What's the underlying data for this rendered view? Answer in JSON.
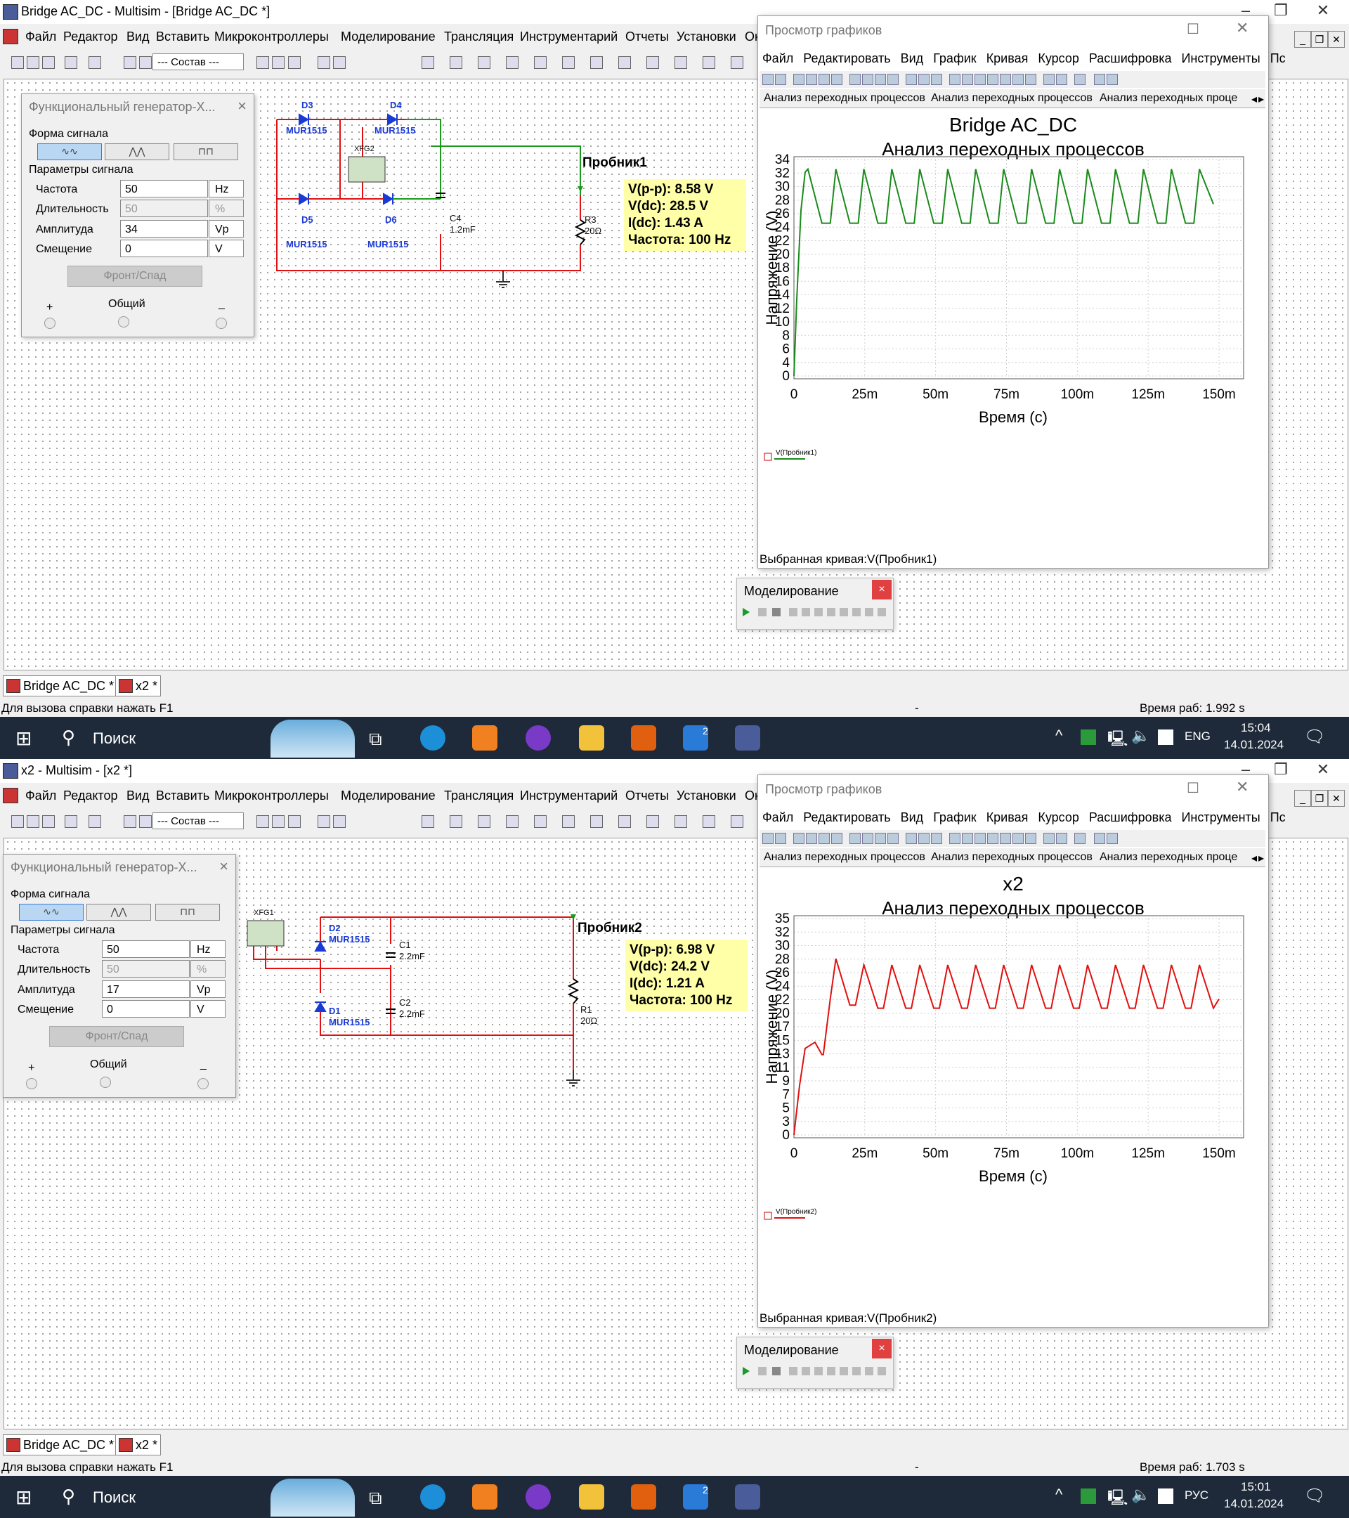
{
  "top": {
    "window_title": "Bridge AC_DC - Multisim - [Bridge AC_DC *]",
    "menu": [
      "Файл",
      "Редактор",
      "Вид",
      "Вставить",
      "Микроконтроллеры",
      "Моделирование",
      "Трансляция",
      "Инструментарий",
      "Отчеты",
      "Установки",
      "Ок"
    ],
    "combo": "--- Состав ---",
    "func_gen": {
      "title": "Функциональный генератор-X...",
      "waveform_label": "Форма сигнала",
      "params_label": "Параметры сигнала",
      "freq_label": "Частота",
      "freq_value": "50",
      "freq_unit": "Hz",
      "duty_label": "Длительность",
      "duty_value": "50",
      "duty_unit": "%",
      "amp_label": "Амплитуда",
      "amp_value": "34",
      "amp_unit": "Vp",
      "offset_label": "Смещение",
      "offset_value": "0",
      "offset_unit": "V",
      "edge_button": "Фронт/Спад",
      "plus": "+",
      "common": "Общий",
      "minus": "_"
    },
    "components": {
      "d3": "D3",
      "d3_model": "MUR1515",
      "d4": "D4",
      "d4_model": "MUR1515",
      "d5": "D5",
      "d5_model": "MUR1515",
      "d6": "D6",
      "d6_model": "MUR1515",
      "xfg": "XFG2",
      "c4": "C4",
      "c4_val": "1.2mF",
      "r3": "R3",
      "r3_val": "20Ω"
    },
    "probe": {
      "name": "Пробник1",
      "vpp": "V(p-p): 8.58 V",
      "vdc": "V(dc): 28.5 V",
      "idc": "I(dc): 1.43 A",
      "freq": "Частота: 100 Hz"
    },
    "grapher": {
      "title": "Просмотр графиков",
      "menu": [
        "Файл",
        "Редактировать",
        "Вид",
        "График",
        "Кривая",
        "Курсор",
        "Расшифровка",
        "Инструменты",
        "Пс"
      ],
      "tabs": [
        "Анализ переходных процессов",
        "Анализ переходных процессов",
        "Анализ переходных проце"
      ],
      "status": "Выбранная кривая:V(Пробник1)"
    },
    "sim": {
      "title": "Моделирование",
      "close": "×"
    },
    "doc_tabs": [
      "Bridge AC_DC *",
      "x2 *"
    ],
    "status_left": "Для вызова справки нажать F1",
    "status_dash": "-",
    "status_right": "Время раб: 1.992 s",
    "taskbar": {
      "search": "Поиск",
      "lang": "ENG",
      "time": "15:04",
      "date": "14.01.2024",
      "badge": "2"
    },
    "chart_data": {
      "type": "line",
      "title": "Bridge AC_DC",
      "subtitle": "Анализ переходных процессов",
      "xlabel": "Время (с)",
      "ylabel": "Напряжение (V)",
      "x_ticks": [
        "0",
        "25m",
        "50m",
        "75m",
        "100m",
        "125m",
        "150m"
      ],
      "y_ticks": [
        "0",
        "4",
        "6",
        "8",
        "10",
        "12",
        "14",
        "16",
        "18",
        "20",
        "22",
        "24",
        "26",
        "28",
        "30",
        "32",
        "34"
      ],
      "xlim": [
        0,
        0.152
      ],
      "ylim": [
        0,
        34
      ],
      "grid": true,
      "series": [
        {
          "name": "V(Пробник1)",
          "color": "#1a8a1a",
          "x": [
            0,
            0.001,
            0.0025,
            0.004,
            0.005,
            0.01,
            0.013,
            0.015,
            0.02,
            0.023,
            0.025,
            0.03,
            0.033,
            0.035,
            0.04,
            0.043,
            0.045,
            0.05,
            0.053,
            0.055,
            0.06,
            0.063,
            0.065,
            0.07,
            0.073,
            0.075,
            0.08,
            0.083,
            0.085,
            0.09,
            0.093,
            0.095,
            0.1,
            0.103,
            0.105,
            0.11,
            0.113,
            0.115,
            0.12,
            0.123,
            0.125,
            0.13,
            0.133,
            0.135,
            0.14,
            0.143,
            0.145,
            0.15,
            0.152
          ],
          "y": [
            0,
            12,
            26,
            32,
            32.5,
            24,
            24,
            32.5,
            24,
            24,
            32.5,
            24,
            24,
            32.5,
            24,
            24,
            32.5,
            24,
            24,
            32.5,
            24,
            24,
            32.5,
            24,
            24,
            32.5,
            24,
            24,
            32.5,
            24,
            24,
            32.5,
            24,
            24,
            32.5,
            24,
            24,
            32.5,
            24,
            24,
            32.5,
            24,
            24,
            32.5,
            24,
            24,
            32.5,
            27
          ]
        }
      ]
    }
  },
  "bottom": {
    "window_title": "x2 - Multisim - [x2 *]",
    "menu": [
      "Файл",
      "Редактор",
      "Вид",
      "Вставить",
      "Микроконтроллеры",
      "Моделирование",
      "Трансляция",
      "Инструментарий",
      "Отчеты",
      "Установки",
      "Ок"
    ],
    "combo": "--- Состав ---",
    "func_gen": {
      "title": "Функциональный генератор-X...",
      "waveform_label": "Форма сигнала",
      "params_label": "Параметры сигнала",
      "freq_label": "Частота",
      "freq_value": "50",
      "freq_unit": "Hz",
      "duty_label": "Длительность",
      "duty_value": "50",
      "duty_unit": "%",
      "amp_label": "Амплитуда",
      "amp_value": "17",
      "amp_unit": "Vp",
      "offset_label": "Смещение",
      "offset_value": "0",
      "offset_unit": "V",
      "edge_button": "Фронт/Спад",
      "plus": "+",
      "common": "Общий",
      "minus": "_"
    },
    "components": {
      "xfg": "XFG1",
      "d2": "D2",
      "d2_model": "MUR1515",
      "d1": "D1",
      "d1_model": "MUR1515",
      "c1": "C1",
      "c1_val": "2.2mF",
      "c2": "C2",
      "c2_val": "2.2mF",
      "r1": "R1",
      "r1_val": "20Ω"
    },
    "probe": {
      "name": "Пробник2",
      "vpp": "V(p-p): 6.98 V",
      "vdc": "V(dc): 24.2 V",
      "idc": "I(dc): 1.21 A",
      "freq": "Частота: 100 Hz"
    },
    "grapher": {
      "title": "Просмотр графиков",
      "menu": [
        "Файл",
        "Редактировать",
        "Вид",
        "График",
        "Кривая",
        "Курсор",
        "Расшифровка",
        "Инструменты",
        "Пс"
      ],
      "tabs": [
        "Анализ переходных процессов",
        "Анализ переходных процессов",
        "Анализ переходных проце"
      ],
      "status": "Выбранная кривая:V(Пробник2)"
    },
    "sim": {
      "title": "Моделирование",
      "close": "×"
    },
    "doc_tabs": [
      "Bridge AC_DC *",
      "x2 *"
    ],
    "status_left": "Для вызова справки нажать F1",
    "status_dash": "-",
    "status_right": "Время раб: 1.703 s",
    "taskbar": {
      "search": "Поиск",
      "lang": "РУС",
      "time": "15:01",
      "date": "14.01.2024",
      "badge": "2"
    },
    "chart_data": {
      "type": "line",
      "title": "x2",
      "subtitle": "Анализ переходных процессов",
      "xlabel": "Время (с)",
      "ylabel": "Напряжение (V)",
      "x_ticks": [
        "0",
        "25m",
        "50m",
        "75m",
        "100m",
        "125m",
        "150m"
      ],
      "y_ticks": [
        "0",
        "3",
        "5",
        "7",
        "9",
        "11",
        "13",
        "15",
        "17",
        "20",
        "22",
        "24",
        "26",
        "28",
        "30",
        "32",
        "35"
      ],
      "xlim": [
        0,
        0.152
      ],
      "ylim": [
        0,
        35
      ],
      "grid": true,
      "series": [
        {
          "name": "V(Пробник2)",
          "color": "#e01010",
          "x": [
            0,
            0.002,
            0.004,
            0.0075,
            0.01,
            0.0105,
            0.013,
            0.015,
            0.02,
            0.022,
            0.025,
            0.03,
            0.032,
            0.035,
            0.04,
            0.042,
            0.045,
            0.05,
            0.052,
            0.055,
            0.06,
            0.062,
            0.065,
            0.07,
            0.072,
            0.075,
            0.08,
            0.082,
            0.085,
            0.09,
            0.092,
            0.095,
            0.1,
            0.102,
            0.105,
            0.11,
            0.112,
            0.115,
            0.12,
            0.122,
            0.125,
            0.13,
            0.132,
            0.135,
            0.14,
            0.142,
            0.145,
            0.15,
            0.152
          ],
          "y": [
            0,
            8,
            14,
            15,
            13,
            13,
            22,
            28.5,
            21,
            21,
            27.5,
            20.5,
            20.5,
            27.5,
            20.5,
            20.5,
            27.5,
            20.5,
            20.5,
            27.5,
            20.5,
            20.5,
            27.5,
            20.5,
            20.5,
            27.5,
            20.5,
            20.5,
            27.5,
            20.5,
            20.5,
            27.5,
            20.5,
            20.5,
            27.5,
            20.5,
            20.5,
            27.5,
            20.5,
            20.5,
            27.5,
            20.5,
            20.5,
            27.5,
            20.5,
            20.5,
            27.5,
            20.5,
            22
          ]
        }
      ]
    }
  }
}
